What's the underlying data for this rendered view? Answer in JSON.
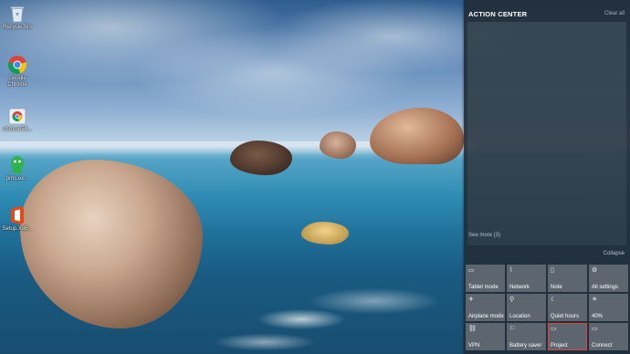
{
  "desktop": {
    "icons": [
      {
        "label": "Recycle Bin",
        "icon": "recycle-bin-icon"
      },
      {
        "label": "Google Chrome",
        "icon": "chrome-icon"
      },
      {
        "label": "chrome54...",
        "icon": "chrome-installer-icon"
      },
      {
        "label": "pms.ex...",
        "icon": "app-green-icon"
      },
      {
        "label": "Setup.X86...",
        "icon": "office-setup-icon"
      }
    ]
  },
  "action_center": {
    "title": "ACTION CENTER",
    "clear_all": "Clear all",
    "see_more": "See more (3)",
    "collapse": "Collapse",
    "tiles": [
      {
        "label": "Tablet mode",
        "icon": "tablet-mode-icon",
        "glyph": "▭"
      },
      {
        "label": "Network",
        "icon": "network-icon",
        "glyph": "⌇"
      },
      {
        "label": "Note",
        "icon": "note-icon",
        "glyph": "▯"
      },
      {
        "label": "All settings",
        "icon": "gear-icon",
        "glyph": "⚙"
      },
      {
        "label": "Airplane mode",
        "icon": "airplane-icon",
        "glyph": "✈"
      },
      {
        "label": "Location",
        "icon": "location-icon",
        "glyph": "⚲"
      },
      {
        "label": "Quiet hours",
        "icon": "moon-icon",
        "glyph": "☾"
      },
      {
        "label": "40%",
        "icon": "brightness-icon",
        "glyph": "☀"
      },
      {
        "label": "VPN",
        "icon": "vpn-icon",
        "glyph": "⛓"
      },
      {
        "label": "Battery saver",
        "icon": "battery-saver-icon",
        "glyph": "⚐"
      },
      {
        "label": "Project",
        "icon": "project-icon",
        "glyph": "▭"
      },
      {
        "label": "Connect",
        "icon": "connect-icon",
        "glyph": "▭"
      }
    ],
    "highlighted_tile": "Project",
    "highlight_color": "#e0443b"
  }
}
